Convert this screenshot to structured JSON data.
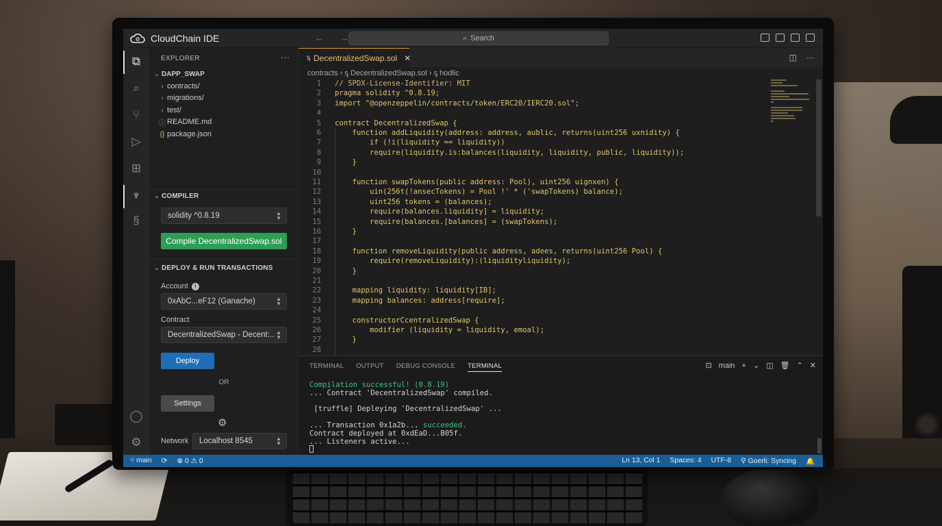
{
  "app": {
    "title": "CloudChain IDE",
    "search_placeholder": "Search",
    "nav": "←  →"
  },
  "explorer": {
    "header": "EXPLORER",
    "more": "···",
    "root": "DAPP_SWAP",
    "items": [
      {
        "chev": "›",
        "icon": "",
        "label": "contracts/"
      },
      {
        "chev": "›",
        "icon": "",
        "label": "migrations/"
      },
      {
        "chev": "›",
        "icon": "",
        "label": "test/"
      },
      {
        "chev": "",
        "icon": "ⓘ",
        "label": "README.md"
      },
      {
        "chev": "",
        "icon": "{}",
        "label": "package.json"
      }
    ]
  },
  "compiler": {
    "title": "COMPILER",
    "version": "solidity ^0.8.19",
    "compile_button": "Compile DecentralizedSwap.sol"
  },
  "deploy": {
    "title": "DEPLOY & RUN TRANSACTIONS",
    "account_label": "Account",
    "account_value": "0xAbC...eF12 (Ganache)",
    "contract_label": "Contract",
    "contract_value": "DecentralizedSwap - Decent:..",
    "deploy_button": "Deploy",
    "or_text": "OR",
    "settings_button": "Settings",
    "network_label": "Network",
    "network_value": "Localhost 8545"
  },
  "editor": {
    "tab": "DecentralizedSwap.sol",
    "breadcrumb": "contracts  ›   ᶊ  DecentralizedSwap.sol  ›  ᶊ  hodlic",
    "lines": [
      "// SPDX-License-Identifier: MIT",
      "pragma solidity ^0.8.19;",
      "import \"@openzeppelin/contracts/token/ERC20/IERC20.sol\";",
      "",
      "contract DecentralizedSwap {",
      "    function addLiquidity(address: address, aublic, returns(uint256 uxnidity) {",
      "        if (!i(liquidity == liquidity))",
      "        require(liquidity.is:balances(liquidity, liquidity, public, liquidity));",
      "    }",
      "",
      "    function swapTokens(public address: Pool), uint256 uignxen) {",
      "        uin(256t(!ansecTokens) = Pool !' * ('swapTokens) balance);",
      "        uint256 tokens = (balances);",
      "        require(balances.liquidity] = liquidity;",
      "        require(balances.[balances] = (swapTokens);",
      "    }",
      "",
      "    function removeLiquidity(public address, adees, returns(uint256 Pool) {",
      "        require(removeLiquidity):(liquidityliquidity);",
      "    }",
      "",
      "    mapping liquidity: liquidity[IB];",
      "    mapping balances: address[require];",
      "",
      "    constructorCcentralizedSwap {",
      "        modifier (liquidity = liquidity, emoal);",
      "    }",
      ""
    ]
  },
  "panel": {
    "tabs": [
      "TERMINAL",
      "OUTPUT",
      "DEBUG CONSOLE",
      "TERMINAL"
    ],
    "shell": "main",
    "terminal": [
      {
        "text": "Compilation successful! (0.8.19)",
        "tone": "green"
      },
      {
        "text": "... Contract 'DecentralizedSwap' compiled.",
        "tone": ""
      },
      {
        "text": "",
        "tone": ""
      },
      {
        "text": " [truffle] Depleying 'DecentralizedSwap' ...",
        "tone": ""
      },
      {
        "text": "",
        "tone": ""
      },
      {
        "text": "... Transaction 0x1a2b... ",
        "tone": "",
        "suffix": "succeeded."
      },
      {
        "text": "Contract deployed at 0xdEaD...B05f.",
        "tone": ""
      },
      {
        "text": "... Listeners active...",
        "tone": ""
      }
    ]
  },
  "status": {
    "branch": "main",
    "problems": "⊗ 0 ⚠ 0",
    "position": "Ln 13, Col 1",
    "spaces": "Spaces: 4",
    "encoding": "UTF-8",
    "network": "Goerli: Syncing"
  },
  "colors": {
    "accent": "#1b5e96",
    "compile_green": "#2e9e57",
    "deploy_blue": "#1f6fb6",
    "code_text": "#e2c56c"
  }
}
